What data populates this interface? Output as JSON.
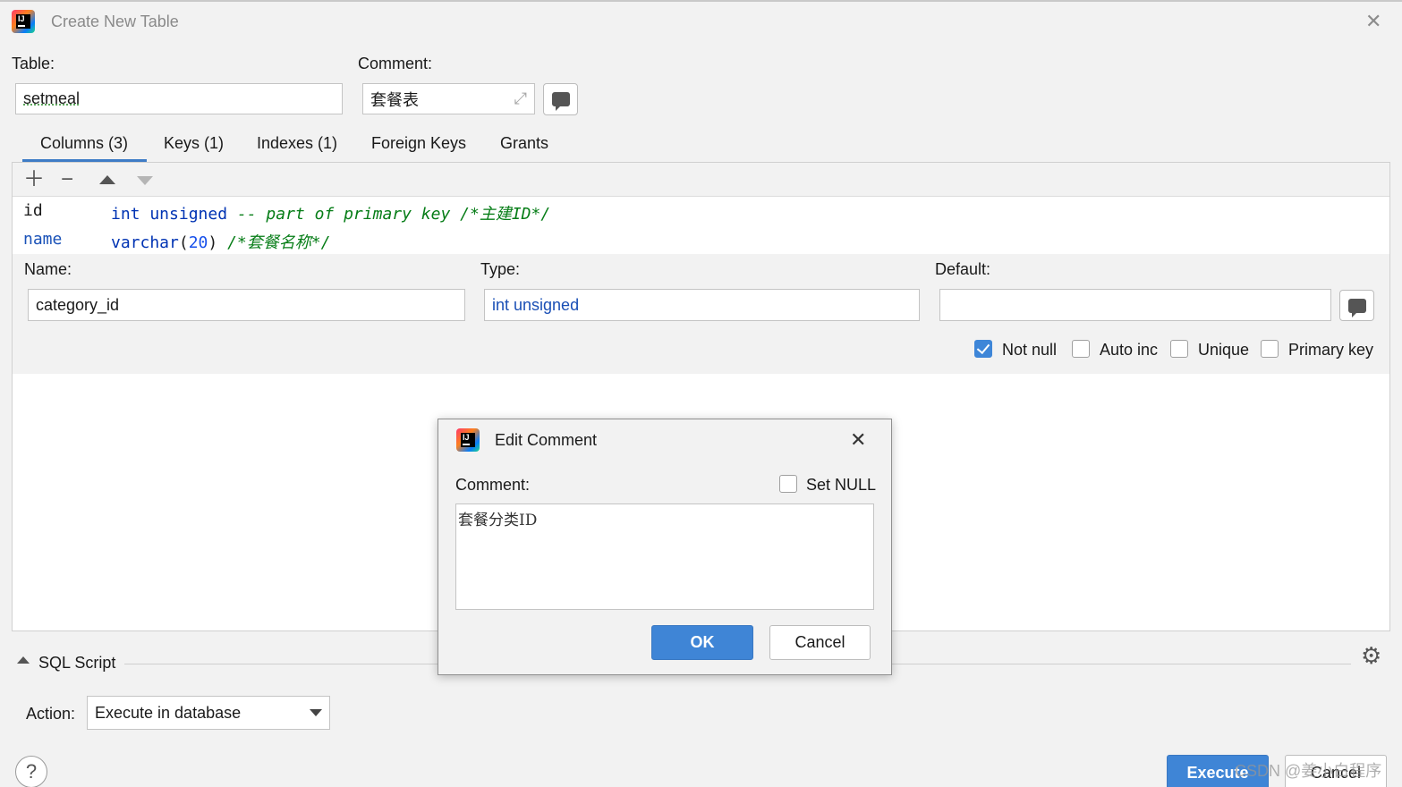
{
  "window": {
    "title": "Create New Table"
  },
  "table_form": {
    "table_label": "Table:",
    "table_value": "setmeal",
    "comment_label": "Comment:",
    "comment_value": "套餐表"
  },
  "tabs": [
    {
      "label": "Columns (3)",
      "active": true
    },
    {
      "label": "Keys (1)"
    },
    {
      "label": "Indexes (1)"
    },
    {
      "label": "Foreign Keys"
    },
    {
      "label": "Grants"
    }
  ],
  "columns": [
    {
      "name": "id",
      "type": "int unsigned",
      "extra": "-- part of primary key",
      "comment": "/*主建ID*/"
    },
    {
      "name": "name",
      "type_kw": "varchar",
      "type_open": "(",
      "type_num": "20",
      "type_close": ")",
      "comment": "/*套餐名称*/"
    }
  ],
  "column_editor": {
    "name_label": "Name:",
    "name_value": "category_id",
    "type_label": "Type:",
    "type_value": "int unsigned",
    "default_label": "Default:",
    "default_value": "",
    "checkboxes": [
      {
        "label": "Not null",
        "checked": true
      },
      {
        "label": "Auto inc",
        "checked": false
      },
      {
        "label": "Unique",
        "checked": false
      },
      {
        "label": "Primary key",
        "checked": false
      }
    ]
  },
  "sql_script": {
    "label": "SQL Script",
    "action_label": "Action:",
    "action_value": "Execute in database"
  },
  "footer": {
    "execute_label": "Execute",
    "cancel_label": "Cancel",
    "help_label": "?"
  },
  "modal": {
    "title": "Edit Comment",
    "comment_label": "Comment:",
    "set_null_label": "Set NULL",
    "set_null_checked": false,
    "comment_value": "套餐分类ID",
    "ok_label": "OK",
    "cancel_label": "Cancel"
  },
  "watermark": "CSDN @姜小白程序",
  "colors": {
    "accent": "#3f85d6",
    "keyword": "#0033b3",
    "comment": "#067d17",
    "number": "#1750eb"
  },
  "icons": [
    "app-logo-icon",
    "close-icon",
    "expand-icon",
    "comment-bubble-icon",
    "add-icon",
    "remove-icon",
    "move-up-icon",
    "move-down-icon",
    "collapse-triangle-icon",
    "gear-icon",
    "dropdown-caret-icon",
    "help-icon"
  ]
}
